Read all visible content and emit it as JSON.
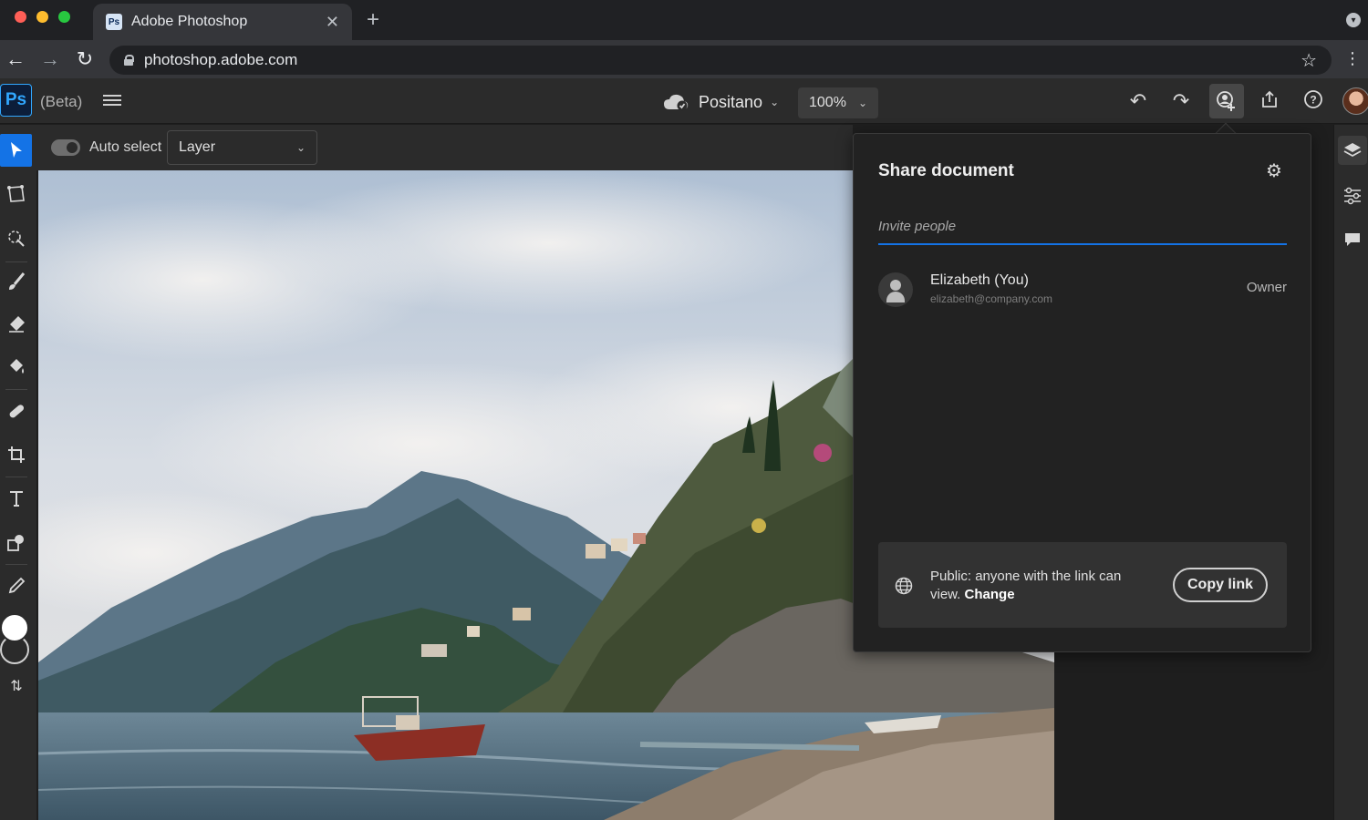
{
  "browser": {
    "tab_title": "Adobe Photoshop",
    "tab_favicon": "Ps",
    "url": "photoshop.adobe.com",
    "icons": [
      "back-icon",
      "forward-icon",
      "reload-icon",
      "lock-icon",
      "star-icon",
      "more-icon"
    ]
  },
  "app": {
    "logo": "Ps",
    "beta_label": "(Beta)",
    "document_name": "Positano",
    "zoom": "100%",
    "brand_color": "#31a8ff",
    "accent_color": "#1473e6"
  },
  "options": {
    "auto_select_label": "Auto select",
    "auto_select_on": true,
    "layer_select_value": "Layer"
  },
  "toolbar": {
    "tools": [
      "move-tool",
      "lasso-tool",
      "quick-selection-tool",
      "brush-tool",
      "eraser-tool",
      "paint-bucket-tool",
      "healing-tool",
      "crop-tool",
      "type-tool",
      "shape-tool",
      "eyedropper-tool"
    ],
    "foreground_color": "#ffffff"
  },
  "share_panel": {
    "title": "Share document",
    "invite_placeholder": "Invite people",
    "people": [
      {
        "name": "Elizabeth (You)",
        "email": "elizabeth@company.com",
        "role": "Owner"
      }
    ],
    "link_text": "Public: anyone with the link can view.",
    "link_change": "Change",
    "copy_link_label": "Copy link"
  }
}
